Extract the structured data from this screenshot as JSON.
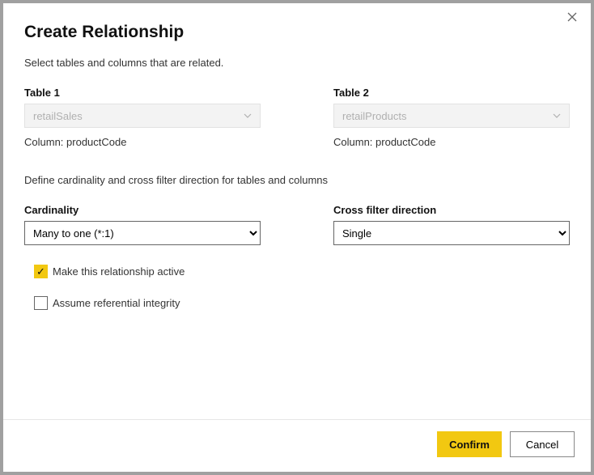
{
  "dialog": {
    "title": "Create Relationship",
    "subtitle": "Select tables and columns that are related.",
    "table1": {
      "label": "Table 1",
      "selected": "retailSales",
      "column_prefix": "Column: ",
      "column": "productCode"
    },
    "table2": {
      "label": "Table 2",
      "selected": "retailProducts",
      "column_prefix": "Column: ",
      "column": "productCode"
    },
    "section_desc": "Define cardinality and cross filter direction for tables and columns",
    "cardinality": {
      "label": "Cardinality",
      "selected": "Many to one (*:1)"
    },
    "cross_filter": {
      "label": "Cross filter direction",
      "selected": "Single"
    },
    "checkbox_active": {
      "label": "Make this relationship active",
      "checked": true
    },
    "checkbox_integrity": {
      "label": "Assume referential integrity",
      "checked": false
    },
    "footer": {
      "confirm": "Confirm",
      "cancel": "Cancel"
    }
  }
}
